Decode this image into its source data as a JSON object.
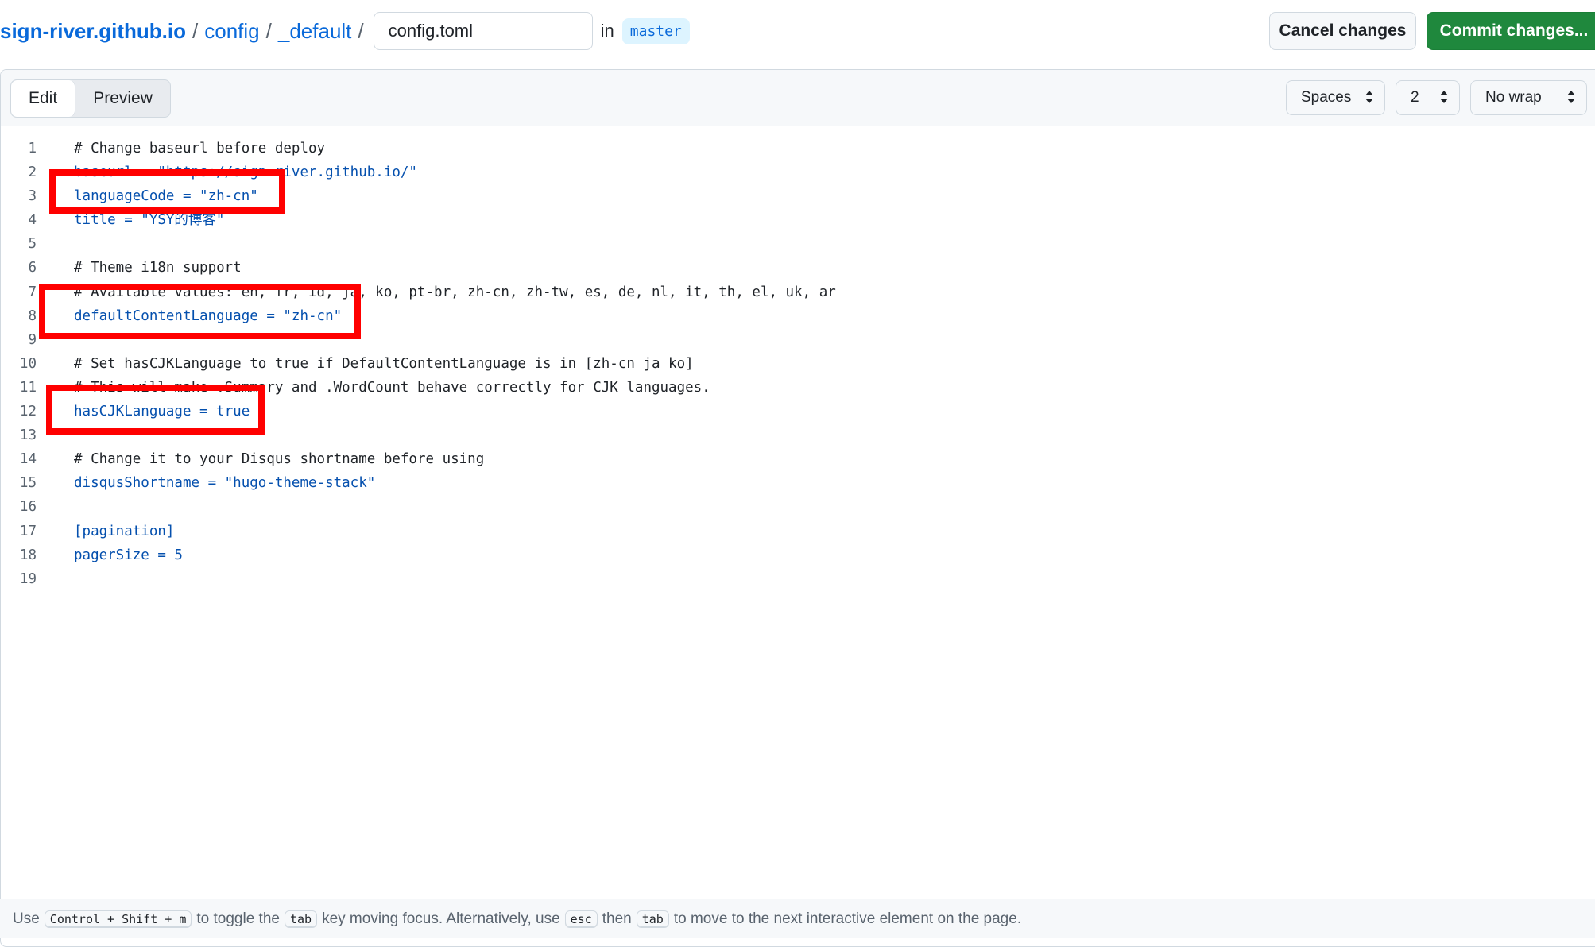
{
  "breadcrumb": {
    "repo": "sign-river.github.io",
    "sep": "/",
    "folder1": "config",
    "folder2": "_default",
    "filename": "config.toml",
    "in_label": "in",
    "branch": "master"
  },
  "actions": {
    "cancel_label": "Cancel changes",
    "commit_label": "Commit changes..."
  },
  "editor_tabs": [
    "Edit",
    "Preview"
  ],
  "selects": {
    "indent_mode": "Spaces",
    "indent_size": "2",
    "wrap_mode": "No wrap",
    "caret_icon": "sort-caret-icon"
  },
  "code_lines": [
    {
      "n": "1",
      "t": "# Change baseurl before deploy",
      "kind": "c"
    },
    {
      "n": "2",
      "t": "baseurl = \"https://sign-river.github.io/\"",
      "kind": "k"
    },
    {
      "n": "3",
      "t": "languageCode = \"zh-cn\"",
      "kind": "k"
    },
    {
      "n": "4",
      "t": "title = \"YSY的博客\"",
      "kind": "k"
    },
    {
      "n": "5",
      "t": "",
      "kind": "c"
    },
    {
      "n": "6",
      "t": "# Theme i18n support",
      "kind": "c"
    },
    {
      "n": "7",
      "t": "# Available values: en, fr, id, ja, ko, pt-br, zh-cn, zh-tw, es, de, nl, it, th, el, uk, ar",
      "kind": "c"
    },
    {
      "n": "8",
      "t": "defaultContentLanguage = \"zh-cn\"",
      "kind": "k"
    },
    {
      "n": "9",
      "t": "",
      "kind": "c"
    },
    {
      "n": "10",
      "t": "# Set hasCJKLanguage to true if DefaultContentLanguage is in [zh-cn ja ko]",
      "kind": "c"
    },
    {
      "n": "11",
      "t": "# This will make .Summary and .WordCount behave correctly for CJK languages.",
      "kind": "c"
    },
    {
      "n": "12",
      "t": "hasCJKLanguage = true",
      "kind": "k"
    },
    {
      "n": "13",
      "t": "",
      "kind": "c"
    },
    {
      "n": "14",
      "t": "# Change it to your Disqus shortname before using",
      "kind": "c"
    },
    {
      "n": "15",
      "t": "disqusShortname = \"hugo-theme-stack\"",
      "kind": "k"
    },
    {
      "n": "16",
      "t": "",
      "kind": "c"
    },
    {
      "n": "17",
      "t": "[pagination]",
      "kind": "k"
    },
    {
      "n": "18",
      "t": "pagerSize = 5",
      "kind": "k"
    },
    {
      "n": "19",
      "t": "",
      "kind": "c"
    }
  ],
  "highlight_color": "#ff0000",
  "footer": {
    "use": "Use",
    "shortcut": "Control + Shift + m",
    "to_toggle": "to toggle the",
    "tab_key": "tab",
    "key_moving": "key moving focus. Alternatively, use",
    "esc_key": "esc",
    "then": "then",
    "tab_key2": "tab",
    "rest": "to move to the next interactive element on the page."
  }
}
